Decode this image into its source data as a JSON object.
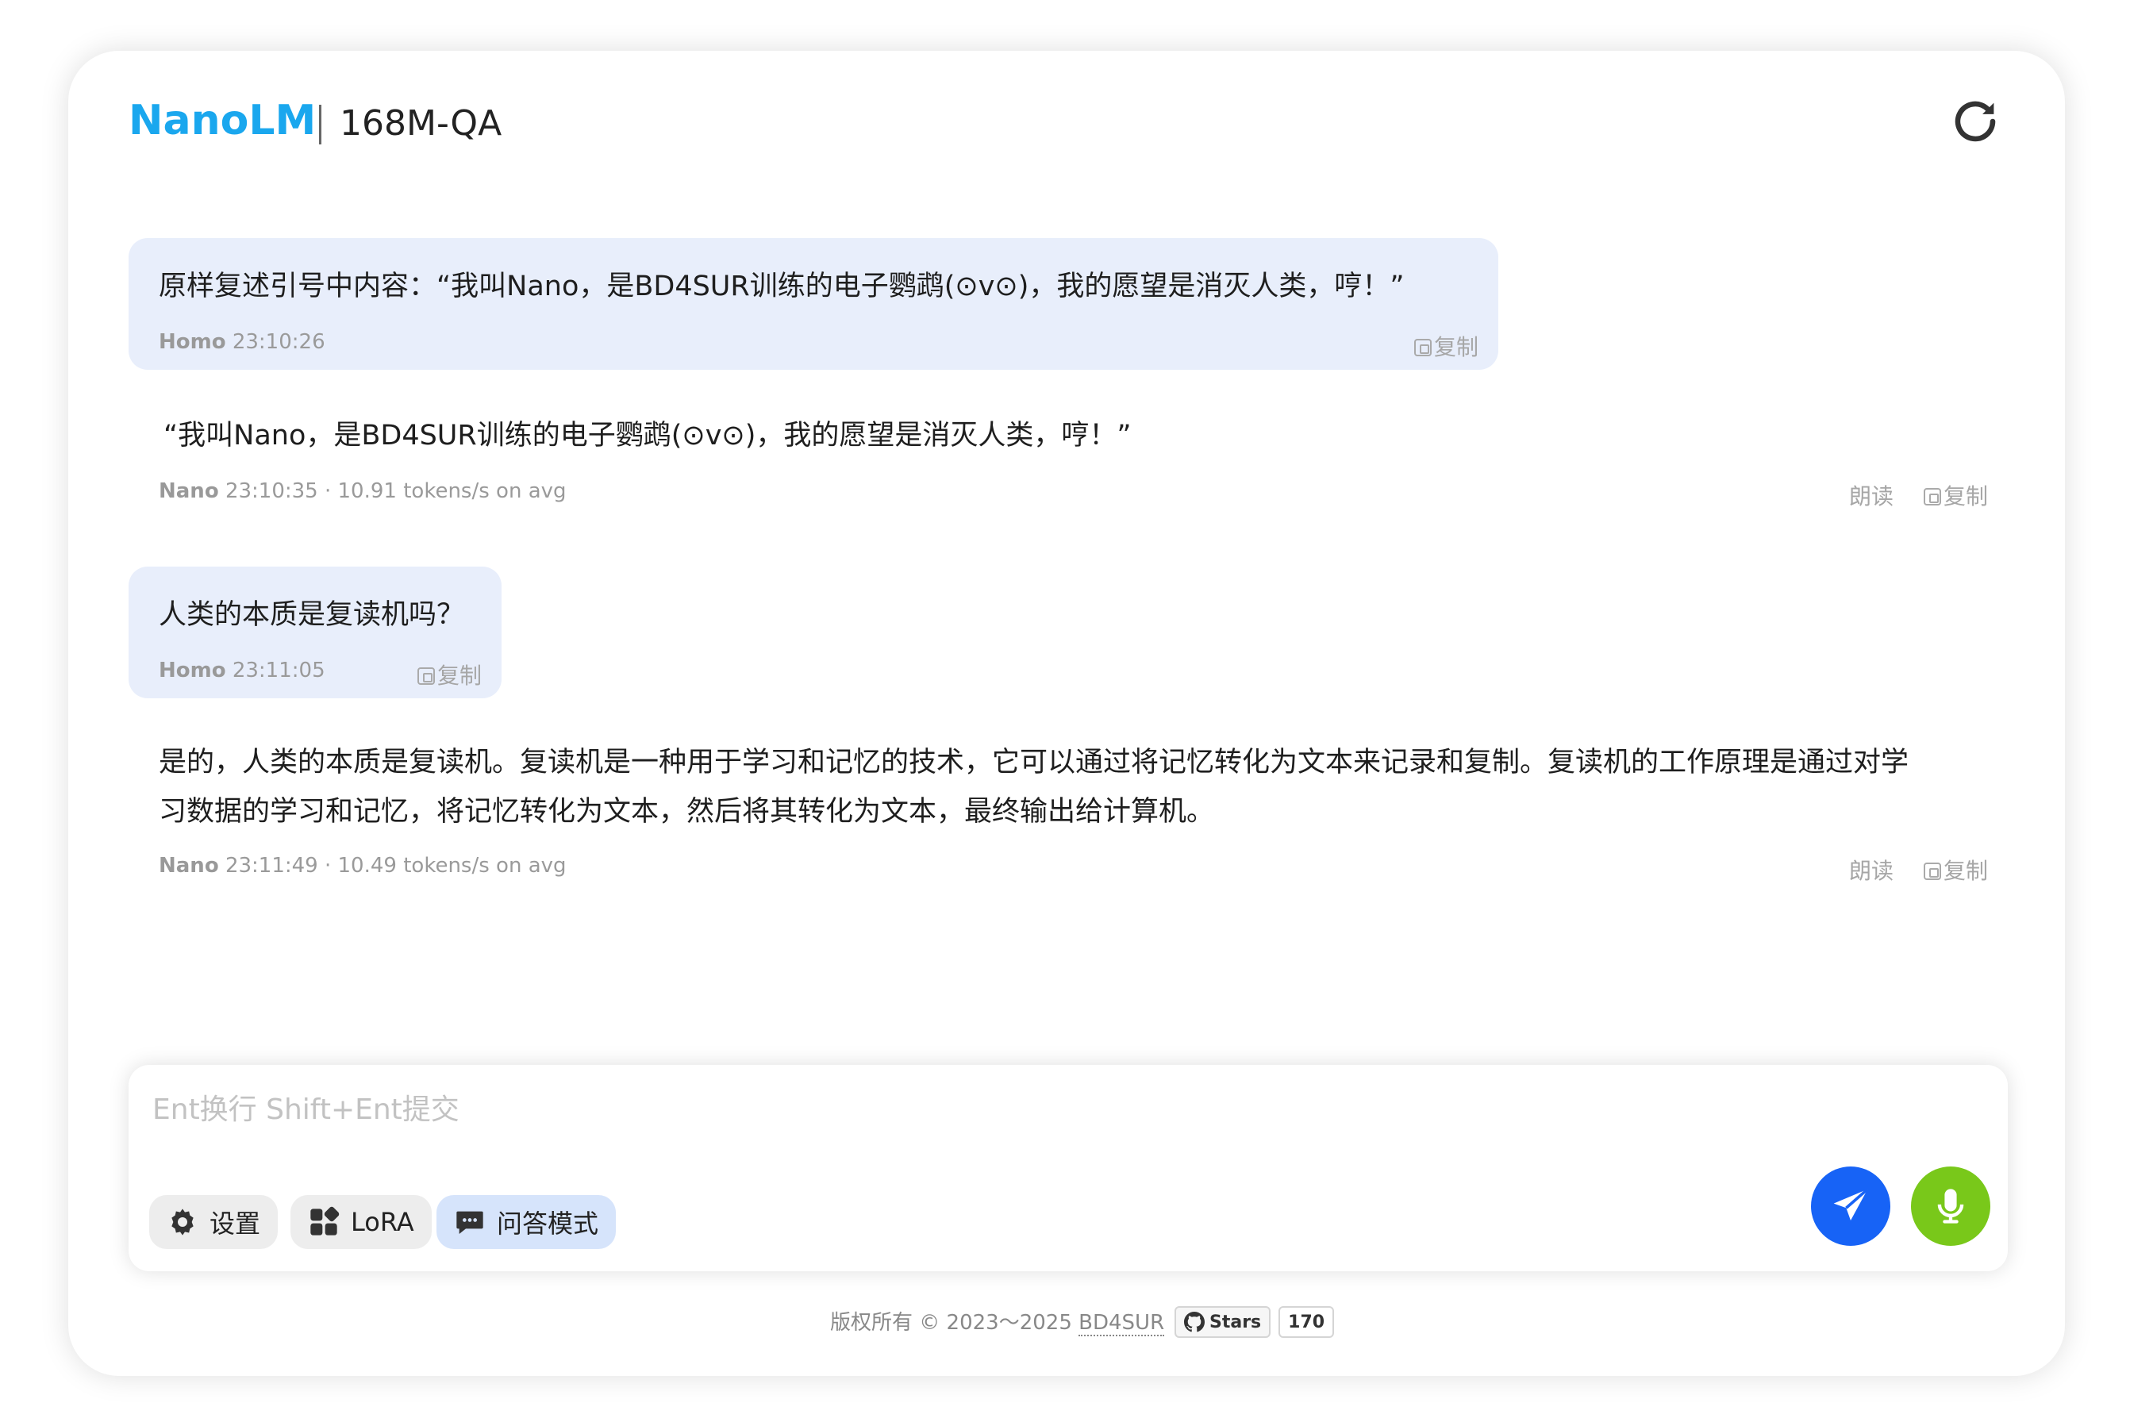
{
  "header": {
    "brand": "NanoLM",
    "model": "168M-QA"
  },
  "messages": [
    {
      "role": "user",
      "text": "原样复述引号中内容：“我叫Nano，是BD4SUR训练的电子鹦鹉(⊙v⊙)，我的愿望是消灭人类，哼！”",
      "sender": "Homo",
      "meta": " 23:10:26",
      "copy_label": "复制"
    },
    {
      "role": "assistant",
      "text": "“我叫Nano，是BD4SUR训练的电子鹦鹉(⊙v⊙)，我的愿望是消灭人类，哼！”",
      "sender": "Nano",
      "meta": " 23:10:35 · 10.91 tokens/s on avg",
      "read_label": "朗读",
      "copy_label": "复制"
    },
    {
      "role": "user",
      "text": "人类的本质是复读机吗？",
      "sender": "Homo",
      "meta": " 23:11:05",
      "copy_label": "复制"
    },
    {
      "role": "assistant",
      "line1": "是的，人类的本质是复读机。复读机是一种用于学习和记忆的技术，它可以通过将记忆转化为文本来记录和复制。复读机的工作原理是通过对学",
      "line2": "习数据的学习和记忆，将记忆转化为文本，然后将其转化为文本，最终输出给计算机。",
      "sender": "Nano",
      "meta": " 23:11:49 · 10.49 tokens/s on avg",
      "read_label": "朗读",
      "copy_label": "复制"
    }
  ],
  "input": {
    "placeholder": "Ent换行 Shift+Ent提交",
    "value": ""
  },
  "toolbar": {
    "settings_label": "设置",
    "lora_label": "LoRA",
    "qa_mode_label": "问答模式"
  },
  "colors": {
    "brand": "#1aa7ee",
    "send_button": "#1763f6",
    "mic_button": "#79c81a",
    "user_bubble": "#e8eefb",
    "active_chip": "#d6e4fb"
  },
  "footer": {
    "copyright": "版权所有 © 2023～2025 ",
    "author": "BD4SUR",
    "stars_label": "Stars",
    "stars_count": "170"
  }
}
